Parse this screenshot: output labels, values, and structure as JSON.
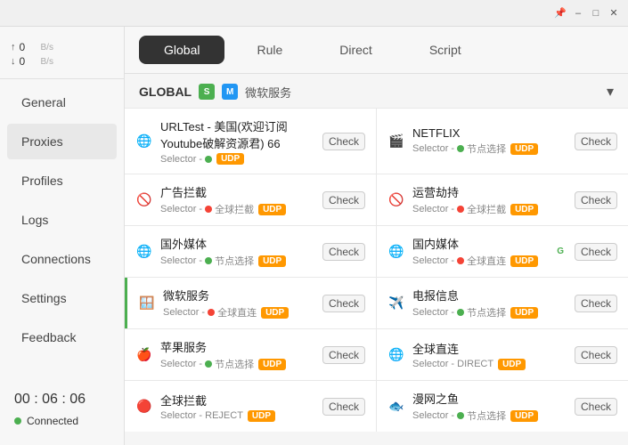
{
  "titlebar": {
    "pin_label": "📌",
    "minimize_label": "–",
    "maximize_label": "□",
    "close_label": "✕"
  },
  "sidebar": {
    "stats": {
      "up_arrow": "↑",
      "down_arrow": "↓",
      "up_value": "0",
      "down_value": "0",
      "unit": "B/s"
    },
    "items": [
      {
        "id": "general",
        "label": "General"
      },
      {
        "id": "proxies",
        "label": "Proxies",
        "active": true
      },
      {
        "id": "profiles",
        "label": "Profiles"
      },
      {
        "id": "logs",
        "label": "Logs"
      },
      {
        "id": "connections",
        "label": "Connections"
      },
      {
        "id": "settings",
        "label": "Settings"
      },
      {
        "id": "feedback",
        "label": "Feedback"
      }
    ],
    "time": "00 : 06 : 06",
    "connection_label": "Connected"
  },
  "tabs": [
    {
      "id": "global",
      "label": "Global",
      "active": true
    },
    {
      "id": "rule",
      "label": "Rule"
    },
    {
      "id": "direct",
      "label": "Direct"
    },
    {
      "id": "script",
      "label": "Script"
    }
  ],
  "panel": {
    "title": "GLOBAL",
    "badge_s": "S",
    "badge_m": "M",
    "service_name": "微软服务",
    "wifi_icon": "▾"
  },
  "rules": [
    {
      "id": "urltest",
      "icon": "🌐",
      "name": "URLTest - 美国(欢迎订阅Youtube破解资源君) 66",
      "selector": "Selector - ",
      "selector_dot": "green",
      "selector_label": "",
      "tag": "UDP",
      "check": "Check",
      "highlight": false
    },
    {
      "id": "netflix",
      "icon": "🎬",
      "name": "NETFLIX",
      "selector": "Selector - ",
      "selector_dot": "green",
      "selector_label": "节点选择",
      "tag": "UDP",
      "check": "Check",
      "highlight": false
    },
    {
      "id": "ad-block",
      "icon": "🚫",
      "name": "广告拦截",
      "selector": "Selector - ",
      "selector_dot": "red",
      "selector_label": "全球拦截",
      "tag": "UDP",
      "check": "Check",
      "highlight": false
    },
    {
      "id": "ops-hijack",
      "icon": "🚫",
      "name": "运营劫持",
      "selector": "Selector - ",
      "selector_dot": "red",
      "selector_label": "全球拦截",
      "tag": "UDP",
      "check": "Check",
      "highlight": false
    },
    {
      "id": "foreign-media",
      "icon": "🌐",
      "name": "国外媒体",
      "selector": "Selector - ",
      "selector_dot": "green",
      "selector_label": "节点选择",
      "tag": "UDP",
      "check": "Check",
      "highlight": false
    },
    {
      "id": "domestic-media",
      "icon": "🌐",
      "name": "国内媒体",
      "selector": "Selector - ",
      "selector_dot": "red",
      "selector_label": "全球直连",
      "tag": "UDP",
      "check": "Check",
      "highlight": true,
      "g_indicator": "G"
    },
    {
      "id": "microsoft",
      "icon": "🪟",
      "name": "微软服务",
      "selector": "Selector - ",
      "selector_dot": "red",
      "selector_label": "全球直连",
      "tag": "UDP",
      "check": "Check",
      "highlight": false
    },
    {
      "id": "telegram",
      "icon": "✈️",
      "name": "电报信息",
      "selector": "Selector - ",
      "selector_dot": "green",
      "selector_label": "节点选择",
      "tag": "UDP",
      "check": "Check",
      "highlight": false
    },
    {
      "id": "apple",
      "icon": "🍎",
      "name": "苹果服务",
      "selector": "Selector - ",
      "selector_dot": "green",
      "selector_label": "节点选择",
      "tag": "UDP",
      "check": "Check",
      "highlight": false
    },
    {
      "id": "global-direct",
      "icon": "🌐",
      "name": "全球直连",
      "selector": "Selector - DIRECT",
      "selector_dot": "none",
      "selector_label": "",
      "tag": "UDP",
      "check": "Check",
      "highlight": false
    },
    {
      "id": "global-block",
      "icon": "🔴",
      "name": "全球拦截",
      "selector": "Selector - REJECT",
      "selector_dot": "none",
      "selector_label": "",
      "tag": "UDP",
      "check": "Check",
      "highlight": false
    },
    {
      "id": "fish",
      "icon": "🐟",
      "name": "漫网之鱼",
      "selector": "Selector - ",
      "selector_dot": "green",
      "selector_label": "节点选择",
      "tag": "UDP",
      "check": "Check",
      "highlight": false
    }
  ]
}
